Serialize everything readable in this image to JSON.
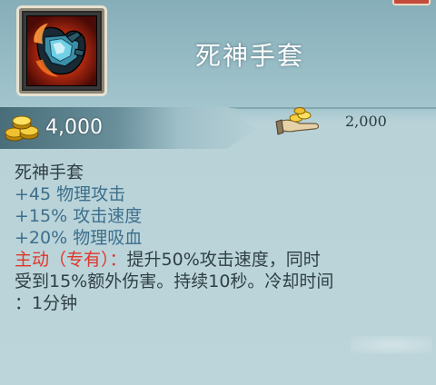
{
  "item": {
    "title": "死神手套",
    "icon": "gauntlet-icon"
  },
  "price": {
    "buy": "4,000",
    "sell": "2,000",
    "buy_icon": "gold-coins-icon",
    "sell_icon": "coins-in-hand-icon"
  },
  "description": {
    "name": "死神手套",
    "stats": [
      "+45 物理攻击",
      "+15% 攻击速度",
      "+20% 物理吸血"
    ],
    "active_label": "主动（专有）：",
    "active_text_1": "提升50%攻击速度，同时",
    "active_text_2": "受到15%额外伤害。持续10秒。冷却时间",
    "active_text_3": "：1分钟"
  },
  "colors": {
    "background": "#bcd5da",
    "title": "#ffffff",
    "stat_text": "#3d6f8c",
    "active_label": "#e0362a",
    "body_text": "#2f3f44"
  }
}
